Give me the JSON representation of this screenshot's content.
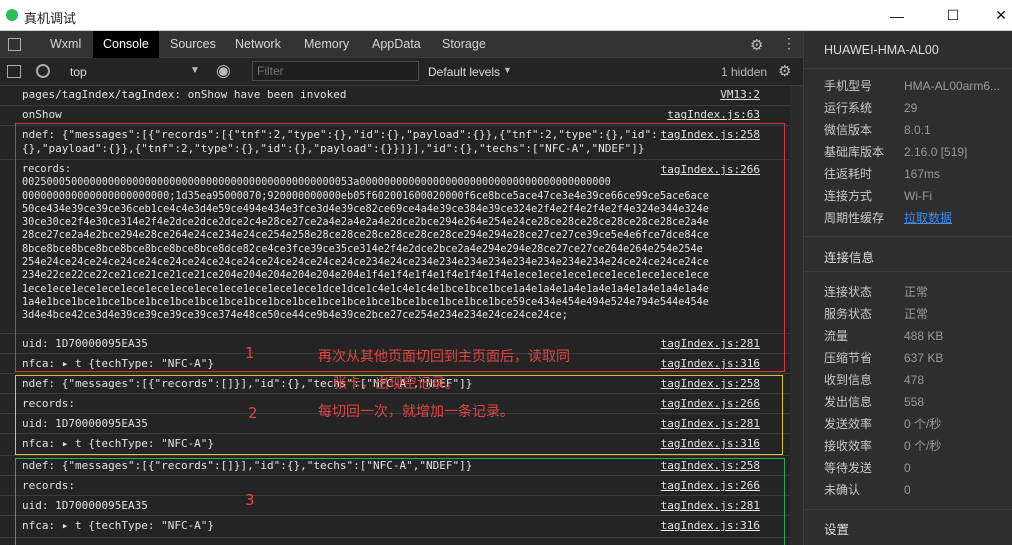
{
  "window": {
    "title": "真机调试",
    "minimize": "—",
    "maximize": "☐",
    "close": "✕"
  },
  "tabs": [
    "Wxml",
    "Console",
    "Sources",
    "Network",
    "Memory",
    "AppData",
    "Storage"
  ],
  "active_tab": "Console",
  "toolbar": {
    "context": "top",
    "filter_placeholder": "Filter",
    "levels": "Default levels",
    "hidden": "1 hidden"
  },
  "console": {
    "rows": [
      {
        "msg": "pages/tagIndex/tagIndex: onShow have been invoked",
        "src": "VM13:2"
      },
      {
        "msg": "onShow",
        "src": "tagIndex.js:63"
      },
      {
        "msg": "ndef: {\"messages\":[{\"records\":[{\"tnf\":2,\"type\":{},\"id\":{},\"payload\":{}},{\"tnf\":2,\"type\":{},\"id\":\n{},\"payload\":{}},{\"tnf\":2,\"type\":{},\"id\":{},\"payload\":{}}]}],\"id\":{},\"techs\":[\"NFC-A\",\"NDEF\"]}",
        "src": "tagIndex.js:258"
      },
      {
        "msg": "records:\n002500050000000000000000000000000000000000000000000053a00000000000000000000000000000000000000000\n000000000000000000000000;1d35ea95000070;920000000000eb05f602001600020000f6ce8bce5ace47ce3e4e39ce66ce99ce5ace6ace\n50ce434e39ce39ce36ceb1ce4c4e3d4e59ce494e434e3fce3d4e39ce82ce69ce4a4e39ce384e39ce324e2f4e2f4e2f4e2f4e324e344e324e\n30ce30ce2f4e30ce314e2f4e2dce2dce2dce2c4e28ce27ce2a4e2a4e2a4e2dce2bce294e264e254e24ce28ce28ce28ce28ce28ce28ce2a4e\n28ce27ce2a4e2bce294e28ce264e24ce234e24ce254e258e28ce28ce28ce28ce28ce28ce294e294e28ce27ce27ce39ce5e4e6fce7dce84ce\n8bce8bce8bce8bce8bce8bce8bce8bce8dce82ce4ce3fce39ce35ce314e2f4e2dce2bce2a4e294e294e28ce27ce27ce264e264e254e254e\n254e24ce24ce24ce24ce24ce24ce24ce24ce24ce24ce24ce24ce24ce234e24ce234e234e234e234e234e234e234e234e24ce24ce24ce24ce\n234e22ce22ce22ce21ce21ce21ce21ce204e204e204e204e204e204e1f4e1f4e1f4e1f4e1f4e1f4e1ece1ece1ece1ece1ece1ece1ece1ece\n1ece1ece1ece1ece1ece1ece1ece1ece1ece1ece1ece1ece1dce1dce1c4e1c4e1c4e1bce1bce1bce1a4e1a4e1a4e1a4e1a4e1a4e1a4e1a4e\n1a4e1bce1bce1bce1bce1bce1bce1bce1bce1bce1bce1bce1bce1bce1bce1bce1bce1bce1bce1bce59ce434e454e494e524e794e544e454e\n3d4e4bce42ce3d4e39ce39ce39ce39ce374e48ce50ce44ce9b4e39ce2bce27ce254e234e234e24ce24ce24ce;",
        "src": "tagIndex.js:266"
      },
      {
        "msg": "uid: 1D70000095EA35",
        "src": "tagIndex.js:281"
      },
      {
        "msg": "nfca: ▸ t {techType: \"NFC-A\"}",
        "src": "tagIndex.js:316"
      },
      {
        "msg": "ndef: {\"messages\":[{\"records\":[]}],\"id\":{},\"techs\":[\"NFC-A\",\"NDEF\"]}",
        "src": "tagIndex.js:258"
      },
      {
        "msg": "records:",
        "src": "tagIndex.js:266"
      },
      {
        "msg": "uid: 1D70000095EA35",
        "src": "tagIndex.js:281"
      },
      {
        "msg": "nfca: ▸ t {techType: \"NFC-A\"}",
        "src": "tagIndex.js:316"
      },
      {
        "msg": "ndef: {\"messages\":[{\"records\":[]}],\"id\":{},\"techs\":[\"NFC-A\",\"NDEF\"]}",
        "src": "tagIndex.js:258"
      },
      {
        "msg": "records:",
        "src": "tagIndex.js:266"
      },
      {
        "msg": "uid: 1D70000095EA35",
        "src": "tagIndex.js:281"
      },
      {
        "msg": "nfca: ▸ t {techType: \"NFC-A\"}",
        "src": "tagIndex.js:316"
      }
    ],
    "annotations": {
      "n1": "1",
      "n2": "2",
      "n3": "3",
      "note1": "再次从其他页面切回到主页面后，读取同",
      "note1b": "张卡，出现空记录。",
      "note2": "每切回一次，就增加一条记录。"
    }
  },
  "sidebar": {
    "device": "HUAWEI-HMA-AL00",
    "info": [
      {
        "label": "手机型号",
        "value": "HMA-AL00arm6..."
      },
      {
        "label": "运行系统",
        "value": "29"
      },
      {
        "label": "微信版本",
        "value": "8.0.1"
      },
      {
        "label": "基础库版本",
        "value": "2.16.0 [519]"
      },
      {
        "label": "往返耗时",
        "value": "167ms"
      },
      {
        "label": "连接方式",
        "value": "Wi-Fi"
      },
      {
        "label": "周期性缓存",
        "value": "拉取数据"
      }
    ],
    "conn_title": "连接信息",
    "conn": [
      {
        "label": "连接状态",
        "value": "正常"
      },
      {
        "label": "服务状态",
        "value": "正常"
      },
      {
        "label": "流量",
        "value": "488 KB"
      },
      {
        "label": "压缩节省",
        "value": "637 KB"
      },
      {
        "label": "收到信息",
        "value": "478"
      },
      {
        "label": "发出信息",
        "value": "558"
      },
      {
        "label": "发送效率",
        "value": "0 个/秒"
      },
      {
        "label": "接收效率",
        "value": "0 个/秒"
      },
      {
        "label": "等待发送",
        "value": "0"
      },
      {
        "label": "未确认",
        "value": "0"
      }
    ],
    "settings": "设置",
    "colors": {
      "ok": "#2bbf5a",
      "link": "#3b8df0"
    }
  }
}
